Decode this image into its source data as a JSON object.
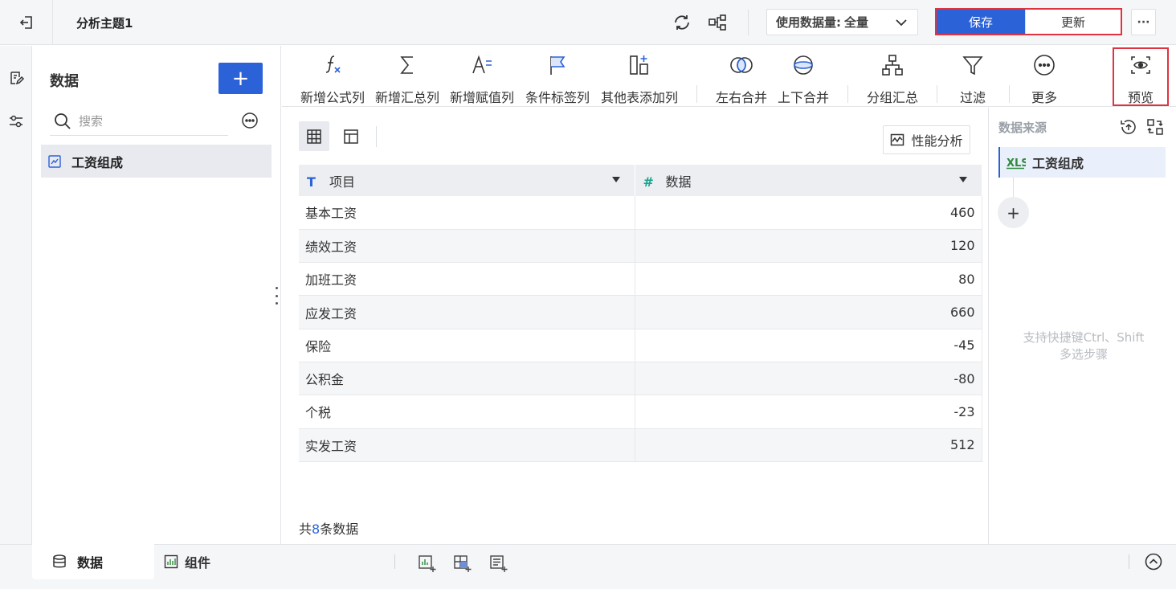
{
  "header": {
    "title": "分析主题1",
    "data_amount_label": "使用数据量:",
    "data_amount_value": "全量",
    "save_label": "保存",
    "update_label": "更新",
    "more_label": "···"
  },
  "left_panel": {
    "title": "数据",
    "add_label": "+",
    "search_placeholder": "搜索",
    "items": [
      {
        "label": "工资组成"
      }
    ]
  },
  "toolbar": {
    "items": [
      {
        "label": "新增公式列"
      },
      {
        "label": "新增汇总列"
      },
      {
        "label": "新增赋值列"
      },
      {
        "label": "条件标签列"
      },
      {
        "label": "其他表添加列"
      },
      {
        "label": "左右合并"
      },
      {
        "label": "上下合并"
      },
      {
        "label": "分组汇总"
      },
      {
        "label": "过滤"
      },
      {
        "label": "更多"
      },
      {
        "label": "预览"
      }
    ]
  },
  "content": {
    "perf_label": "性能分析",
    "table": {
      "columns": [
        {
          "icon": "T",
          "label": "项目"
        },
        {
          "icon": "#",
          "label": "数据"
        }
      ],
      "rows": [
        [
          "基本工资",
          "460"
        ],
        [
          "绩效工资",
          "120"
        ],
        [
          "加班工资",
          "80"
        ],
        [
          "应发工资",
          "660"
        ],
        [
          "保险",
          "-45"
        ],
        [
          "公积金",
          "-80"
        ],
        [
          "个税",
          "-23"
        ],
        [
          "实发工资",
          "512"
        ]
      ]
    },
    "count_prefix": "共",
    "count": "8",
    "count_suffix": "条数据"
  },
  "right_panel": {
    "title": "数据来源",
    "source_label": "工资组成",
    "add_label": "+",
    "hint_line1": "支持快捷键Ctrl、Shift",
    "hint_line2": "多选步骤"
  },
  "bottom": {
    "tab_data": "数据",
    "tab_component": "组件"
  },
  "colors": {
    "primary": "#2c62d8",
    "highlight_border": "#e0333f",
    "number_column_icon": "#19a38a"
  }
}
